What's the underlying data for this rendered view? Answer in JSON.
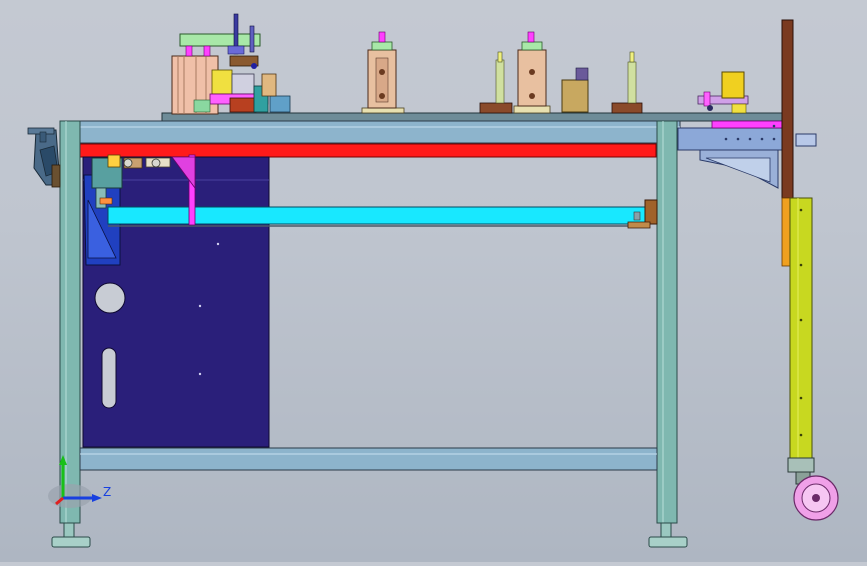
{
  "viewport": {
    "background": [
      "#c4c9d2",
      "#aeb6c2"
    ]
  },
  "triad": {
    "axis_y_label": "",
    "axis_z_label": "Z",
    "colors": {
      "y": "#18c018",
      "z": "#1840e0",
      "x": "#e02020"
    }
  },
  "colors": {
    "frame": "#7fb8b0",
    "frame_dark": "#3a6a6a",
    "beam_blue": "#78a0c8",
    "red_bar": "#ff1a1a",
    "cyan_bar": "#18e8ff",
    "cabinet": "#2a1f7a",
    "magenta": "#ff40ff",
    "brown": "#8a4a2a",
    "olive": "#c8d820",
    "pink_wheel": "#f0a0e8"
  }
}
